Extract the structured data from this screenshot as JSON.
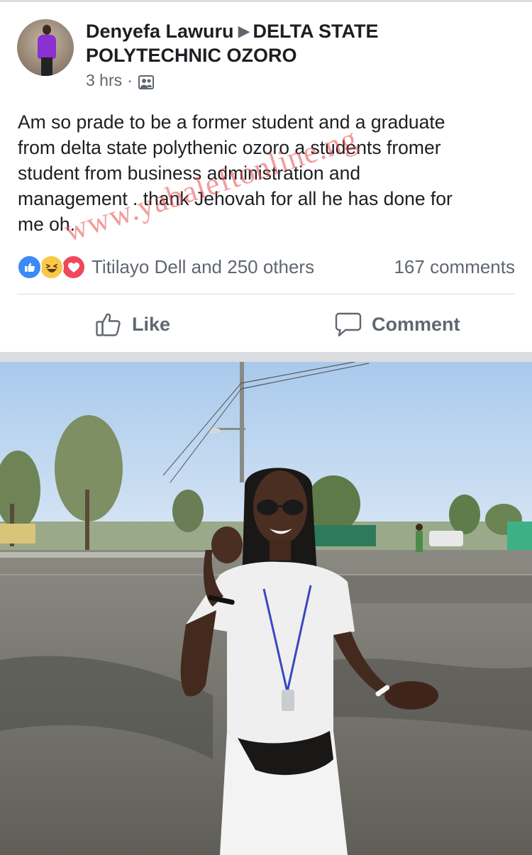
{
  "post": {
    "author": {
      "name": "Denyefa Lawuru",
      "arrow": "▶",
      "group": "DELTA STATE POLYTECHNIC OZORO",
      "avatar_icon": "profile-photo"
    },
    "time": "3 hrs",
    "separator": "·",
    "audience_icon": "group-members-icon",
    "text": "Am so prade to be a former student and a graduate\nfrom delta state polythenic ozoro  a students fromer\nstudent from business administration and\nmanagement . thank Jehovah for all he has done for\nme oh.",
    "watermark": "www.yabaleftonline.ng"
  },
  "reactions": {
    "icons": [
      "like-reaction-icon",
      "haha-reaction-icon",
      "love-reaction-icon"
    ],
    "names": "Titilayo Dell and 250 others",
    "comments": "167 comments"
  },
  "actions": {
    "like_label": "Like",
    "comment_label": "Comment"
  },
  "colors": {
    "meta_text": "#606770",
    "like_blue": "#3b8af5",
    "love_red": "#f0475a",
    "haha_yellow": "#f7c84a",
    "watermark_red": "#e84a4a",
    "separator_gray": "#dcdde1"
  }
}
